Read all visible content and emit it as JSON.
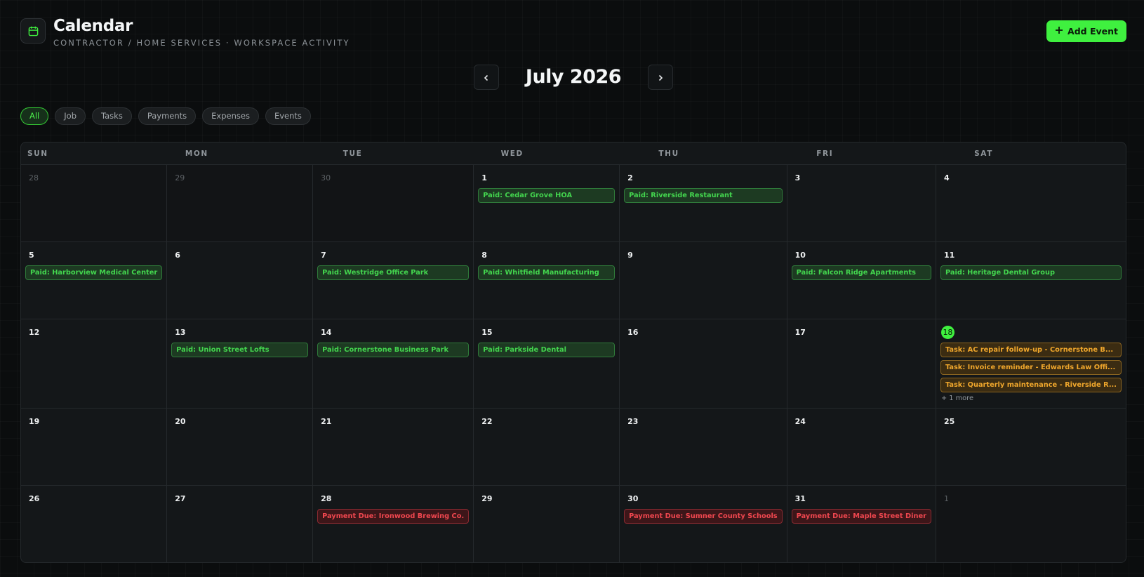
{
  "header": {
    "title": "Calendar",
    "subtitle": "CONTRACTOR / HOME SERVICES · WORKSPACE ACTIVITY",
    "app_icon": "calendar-icon"
  },
  "add_button": {
    "label": "Add Event",
    "icon": "plus-icon"
  },
  "nav": {
    "month_title": "July 2026",
    "prev_icon": "chevron-left-icon",
    "next_icon": "chevron-right-icon"
  },
  "filters": [
    {
      "label": "All",
      "active": true
    },
    {
      "label": "Job",
      "active": false
    },
    {
      "label": "Tasks",
      "active": false
    },
    {
      "label": "Payments",
      "active": false
    },
    {
      "label": "Expenses",
      "active": false
    },
    {
      "label": "Events",
      "active": false
    }
  ],
  "colors": {
    "accent": "#3ff03f",
    "paid": "#43d54e",
    "task": "#f0a72c",
    "payment_due": "#f0474f"
  },
  "calendar": {
    "weekdays": [
      "SUN",
      "MON",
      "TUE",
      "WED",
      "THU",
      "FRI",
      "SAT"
    ],
    "days": [
      {
        "day": "28",
        "other": true,
        "events": []
      },
      {
        "day": "29",
        "other": true,
        "events": []
      },
      {
        "day": "30",
        "other": true,
        "events": []
      },
      {
        "day": "1",
        "events": [
          {
            "type": "paid",
            "label": "Paid: Cedar Grove HOA"
          }
        ]
      },
      {
        "day": "2",
        "events": [
          {
            "type": "paid",
            "label": "Paid: Riverside Restaurant"
          }
        ]
      },
      {
        "day": "3",
        "events": []
      },
      {
        "day": "4",
        "events": []
      },
      {
        "day": "5",
        "events": [
          {
            "type": "paid",
            "label": "Paid: Harborview Medical Center"
          }
        ]
      },
      {
        "day": "6",
        "events": []
      },
      {
        "day": "7",
        "events": [
          {
            "type": "paid",
            "label": "Paid: Westridge Office Park"
          }
        ]
      },
      {
        "day": "8",
        "events": [
          {
            "type": "paid",
            "label": "Paid: Whitfield Manufacturing"
          }
        ]
      },
      {
        "day": "9",
        "events": []
      },
      {
        "day": "10",
        "events": [
          {
            "type": "paid",
            "label": "Paid: Falcon Ridge Apartments"
          }
        ]
      },
      {
        "day": "11",
        "events": [
          {
            "type": "paid",
            "label": "Paid: Heritage Dental Group"
          }
        ]
      },
      {
        "day": "12",
        "events": []
      },
      {
        "day": "13",
        "events": [
          {
            "type": "paid",
            "label": "Paid: Union Street Lofts"
          }
        ]
      },
      {
        "day": "14",
        "events": [
          {
            "type": "paid",
            "label": "Paid: Cornerstone Business Park"
          }
        ]
      },
      {
        "day": "15",
        "events": [
          {
            "type": "paid",
            "label": "Paid: Parkside Dental"
          }
        ]
      },
      {
        "day": "16",
        "events": []
      },
      {
        "day": "17",
        "events": []
      },
      {
        "day": "18",
        "today": true,
        "events": [
          {
            "type": "task",
            "label": "Task: AC repair follow-up - Cornerstone B..."
          },
          {
            "type": "task",
            "label": "Task: Invoice reminder - Edwards Law Offi..."
          },
          {
            "type": "task",
            "label": "Task: Quarterly maintenance - Riverside R..."
          }
        ],
        "more": "+ 1 more"
      },
      {
        "day": "19",
        "events": []
      },
      {
        "day": "20",
        "events": []
      },
      {
        "day": "21",
        "events": []
      },
      {
        "day": "22",
        "events": []
      },
      {
        "day": "23",
        "events": []
      },
      {
        "day": "24",
        "events": []
      },
      {
        "day": "25",
        "events": []
      },
      {
        "day": "26",
        "events": []
      },
      {
        "day": "27",
        "events": []
      },
      {
        "day": "28",
        "events": [
          {
            "type": "due",
            "label": "Payment Due: Ironwood Brewing Co."
          }
        ]
      },
      {
        "day": "29",
        "events": []
      },
      {
        "day": "30",
        "events": [
          {
            "type": "due",
            "label": "Payment Due: Sumner County Schools"
          }
        ]
      },
      {
        "day": "31",
        "events": [
          {
            "type": "due",
            "label": "Payment Due: Maple Street Diner"
          }
        ]
      },
      {
        "day": "1",
        "other": true,
        "events": []
      }
    ]
  }
}
